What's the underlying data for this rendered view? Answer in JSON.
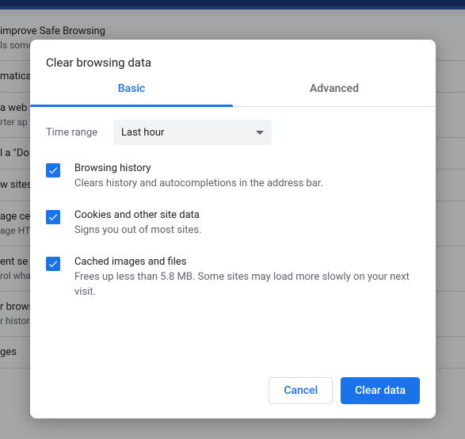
{
  "bg": {
    "rows": [
      {
        "title": "improve Safe Browsing",
        "sub": "ls some system information and page content to Google"
      },
      {
        "title": "matically",
        "sub": ""
      },
      {
        "title": "a web",
        "sub": "rter sp"
      },
      {
        "title": "l a \"Do",
        "sub": ""
      },
      {
        "title": "w sites",
        "sub": ""
      },
      {
        "title": "age ce",
        "sub": "age HT"
      },
      {
        "title": "ent se",
        "sub": "rol wha"
      },
      {
        "title": "r brows",
        "sub": "r histor"
      },
      {
        "title": "ges",
        "sub": ""
      }
    ]
  },
  "dialog": {
    "title": "Clear browsing data",
    "tabs": {
      "basic": "Basic",
      "advanced": "Advanced"
    },
    "time_label": "Time range",
    "time_value": "Last hour",
    "options": [
      {
        "title": "Browsing history",
        "desc": "Clears history and autocompletions in the address bar."
      },
      {
        "title": "Cookies and other site data",
        "desc": "Signs you out of most sites."
      },
      {
        "title": "Cached images and files",
        "desc": "Frees up less than 5.8 MB. Some sites may load more slowly on your next visit."
      }
    ],
    "cancel": "Cancel",
    "clear": "Clear data"
  }
}
